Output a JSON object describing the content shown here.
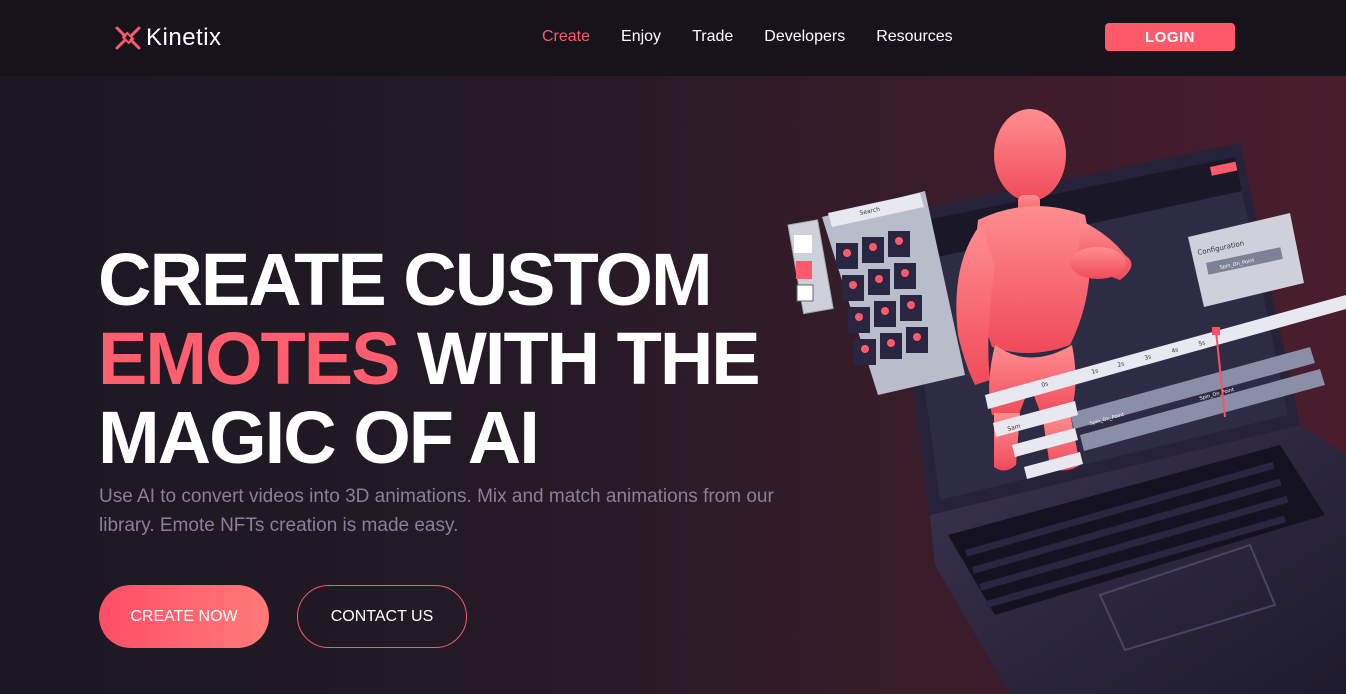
{
  "header": {
    "logo_text": "Kinetix",
    "nav": [
      "Create",
      "Enjoy",
      "Trade",
      "Developers",
      "Resources"
    ],
    "active_nav": "Create",
    "login_label": "LOGIN"
  },
  "hero": {
    "headline_line1": "CREATE CUSTOM",
    "headline_accent": "EMOTES",
    "headline_line2_rest": " WITH THE",
    "headline_line3": "MAGIC OF AI",
    "subtitle": "Use AI to convert videos into 3D animations. Mix and match animations from our library. Emote NFTs creation is made easy.",
    "primary_cta": "CREATE NOW",
    "secondary_cta": "CONTACT US"
  },
  "illustration": {
    "search_placeholder": "Search",
    "config_title": "Configuration",
    "clip_label": "Spin_On_Point",
    "user_label": "Sam",
    "timeline_ticks": [
      "0s",
      "1s",
      "2s",
      "3s",
      "4s",
      "5s"
    ]
  },
  "colors": {
    "accent": "#ff5a6b",
    "background": "#1a1620",
    "header_bg": "#16131b"
  }
}
